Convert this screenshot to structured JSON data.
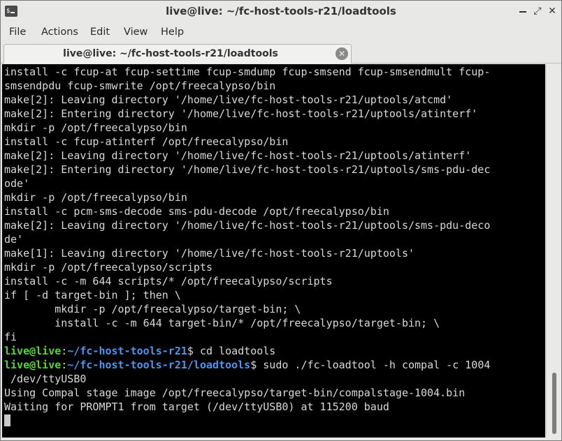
{
  "window": {
    "title": "live@live: ~/fc-host-tools-r21/loadtools",
    "icon_text": "$",
    "controls": [
      "minimize-icon",
      "maximize-icon",
      "close-icon"
    ],
    "close_glyph": "✕",
    "max_glyph": "⤢"
  },
  "menu": {
    "file": "File",
    "actions": "Actions",
    "edit": "Edit",
    "view": "View",
    "help": "Help"
  },
  "tab": {
    "label": "live@live: ~/fc-host-tools-r21/loadtools",
    "close_glyph": "✕"
  },
  "terminal": {
    "lines": [
      "install -c fcup-at fcup-settime fcup-smdump fcup-smsend fcup-smsendmult fcup-",
      "smsendpdu fcup-smwrite /opt/freecalypso/bin",
      "make[2]: Leaving directory '/home/live/fc-host-tools-r21/uptools/atcmd'",
      "make[2]: Entering directory '/home/live/fc-host-tools-r21/uptools/atinterf'",
      "mkdir -p /opt/freecalypso/bin",
      "install -c fcup-atinterf /opt/freecalypso/bin",
      "make[2]: Leaving directory '/home/live/fc-host-tools-r21/uptools/atinterf'",
      "make[2]: Entering directory '/home/live/fc-host-tools-r21/uptools/sms-pdu-dec",
      "ode'",
      "mkdir -p /opt/freecalypso/bin",
      "install -c pcm-sms-decode sms-pdu-decode /opt/freecalypso/bin",
      "make[2]: Leaving directory '/home/live/fc-host-tools-r21/uptools/sms-pdu-deco",
      "de'",
      "make[1]: Leaving directory '/home/live/fc-host-tools-r21/uptools'",
      "mkdir -p /opt/freecalypso/scripts",
      "install -c -m 644 scripts/* /opt/freecalypso/scripts",
      "if [ -d target-bin ]; then \\",
      "        mkdir -p /opt/freecalypso/target-bin; \\",
      "        install -c -m 644 target-bin/* /opt/freecalypso/target-bin; \\",
      "fi"
    ],
    "prompt1": {
      "user": "live@live",
      "sep": ":",
      "path": "~/fc-host-tools-r21",
      "sym": "$",
      "cmd": " cd loadtools"
    },
    "prompt2": {
      "user": "live@live",
      "sep": ":",
      "path": "~/fc-host-tools-r21/loadtools",
      "sym": "$",
      "cmd": " sudo ./fc-loadtool -h compal -c 1004"
    },
    "after_lines": [
      " /dev/ttyUSB0",
      "Using Compal stage image /opt/freecalypso/target-bin/compalstage-1004.bin",
      "Waiting for PROMPT1 from target (/dev/ttyUSB0) at 115200 baud"
    ]
  },
  "colors": {
    "terminal_bg": "#000000",
    "terminal_fg": "#d9d9d9",
    "prompt_user": "#55d832",
    "prompt_path": "#4c96f2"
  }
}
